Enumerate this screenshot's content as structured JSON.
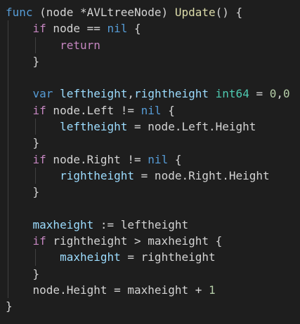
{
  "lines": [
    [
      [
        "kw",
        "func"
      ],
      [
        "plain",
        " (node *AVLtreeNode) "
      ],
      [
        "fn",
        "Update"
      ],
      [
        "plain",
        "() {"
      ]
    ],
    [
      [
        "plain",
        "    "
      ],
      [
        "ctrl",
        "if"
      ],
      [
        "plain",
        " node == "
      ],
      [
        "kw",
        "nil"
      ],
      [
        "plain",
        " {"
      ]
    ],
    [
      [
        "plain",
        "        "
      ],
      [
        "ctrl",
        "return"
      ]
    ],
    [
      [
        "plain",
        "    }"
      ]
    ],
    [
      [
        "plain",
        ""
      ]
    ],
    [
      [
        "plain",
        "    "
      ],
      [
        "kw",
        "var"
      ],
      [
        "plain",
        " "
      ],
      [
        "var",
        "leftheight"
      ],
      [
        "plain",
        ","
      ],
      [
        "var",
        "rightheight"
      ],
      [
        "plain",
        " "
      ],
      [
        "type",
        "int64"
      ],
      [
        "plain",
        " = "
      ],
      [
        "num",
        "0"
      ],
      [
        "plain",
        ","
      ],
      [
        "num",
        "0"
      ]
    ],
    [
      [
        "plain",
        "    "
      ],
      [
        "ctrl",
        "if"
      ],
      [
        "plain",
        " node.Left != "
      ],
      [
        "kw",
        "nil"
      ],
      [
        "plain",
        " {"
      ]
    ],
    [
      [
        "plain",
        "        "
      ],
      [
        "var",
        "leftheight"
      ],
      [
        "plain",
        " = node.Left.Height"
      ]
    ],
    [
      [
        "plain",
        "    }"
      ]
    ],
    [
      [
        "plain",
        "    "
      ],
      [
        "ctrl",
        "if"
      ],
      [
        "plain",
        " node.Right != "
      ],
      [
        "kw",
        "nil"
      ],
      [
        "plain",
        " {"
      ]
    ],
    [
      [
        "plain",
        "        "
      ],
      [
        "var",
        "rightheight"
      ],
      [
        "plain",
        " = node.Right.Height"
      ]
    ],
    [
      [
        "plain",
        "    }"
      ]
    ],
    [
      [
        "plain",
        ""
      ]
    ],
    [
      [
        "plain",
        "    "
      ],
      [
        "var",
        "maxheight"
      ],
      [
        "plain",
        " := leftheight"
      ]
    ],
    [
      [
        "plain",
        "    "
      ],
      [
        "ctrl",
        "if"
      ],
      [
        "plain",
        " rightheight > maxheight {"
      ]
    ],
    [
      [
        "plain",
        "        "
      ],
      [
        "var",
        "maxheight"
      ],
      [
        "plain",
        " = rightheight"
      ]
    ],
    [
      [
        "plain",
        "    }"
      ]
    ],
    [
      [
        "plain",
        "    node.Height = maxheight + "
      ],
      [
        "num",
        "1"
      ]
    ],
    [
      [
        "plain",
        "}"
      ]
    ]
  ],
  "guides": {
    "level1_lines": [
      1,
      2,
      3,
      4,
      5,
      6,
      7,
      8,
      9,
      10,
      11,
      12,
      13,
      14,
      15,
      16,
      17
    ],
    "level2_lines": [
      2,
      7,
      10,
      15
    ]
  },
  "colors": {
    "background": "#1e1e1e",
    "keyword": "#569cd6",
    "control": "#c586c0",
    "function": "#dcdcaa",
    "variable": "#9cdcfe",
    "type": "#4ec9b0",
    "number": "#b5cea8",
    "plain": "#d4d4d4",
    "indent_guide": "#404040"
  }
}
